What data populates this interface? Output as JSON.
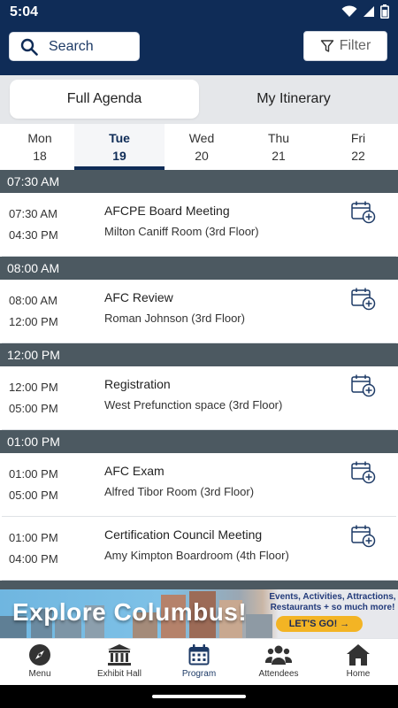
{
  "status": {
    "time": "5:04"
  },
  "search": {
    "label": "Search"
  },
  "filter": {
    "label": "Filter"
  },
  "segments": [
    {
      "label": "Full Agenda",
      "active": true
    },
    {
      "label": "My Itinerary",
      "active": false
    }
  ],
  "days": [
    {
      "name": "Mon",
      "num": "18"
    },
    {
      "name": "Tue",
      "num": "19",
      "active": true
    },
    {
      "name": "Wed",
      "num": "20"
    },
    {
      "name": "Thu",
      "num": "21"
    },
    {
      "name": "Fri",
      "num": "22"
    }
  ],
  "groups": [
    {
      "header": "07:30 AM",
      "events": [
        {
          "start": "07:30 AM",
          "end": "04:30 PM",
          "title": "AFCPE Board Meeting",
          "room": "Milton Caniff Room (3rd Floor)"
        }
      ]
    },
    {
      "header": "08:00 AM",
      "events": [
        {
          "start": "08:00 AM",
          "end": "12:00 PM",
          "title": "AFC Review",
          "room": "Roman Johnson (3rd Floor)"
        }
      ]
    },
    {
      "header": "12:00 PM",
      "events": [
        {
          "start": "12:00 PM",
          "end": "05:00 PM",
          "title": "Registration",
          "room": "West Prefunction space (3rd Floor)"
        }
      ]
    },
    {
      "header": "01:00 PM",
      "events": [
        {
          "start": "01:00 PM",
          "end": "05:00 PM",
          "title": "AFC Exam",
          "room": "Alfred Tibor Room (3rd Floor)"
        },
        {
          "start": "01:00 PM",
          "end": "04:00 PM",
          "title": "Certification Council Meeting",
          "room": "Amy Kimpton Boardroom (4th Floor)"
        }
      ]
    }
  ],
  "banner": {
    "headline": "Explore Columbus!",
    "promo": "Events, Activities, Attractions, Restaurants + so much more!",
    "cta": "LET'S GO! →"
  },
  "nav": [
    {
      "label": "Menu",
      "icon": "compass-icon"
    },
    {
      "label": "Exhibit Hall",
      "icon": "building-icon"
    },
    {
      "label": "Program",
      "icon": "calendar-icon",
      "active": true
    },
    {
      "label": "Attendees",
      "icon": "people-icon"
    },
    {
      "label": "Home",
      "icon": "home-icon"
    }
  ],
  "colors": {
    "primary": "#0f2c57",
    "header": "#4c5961"
  }
}
